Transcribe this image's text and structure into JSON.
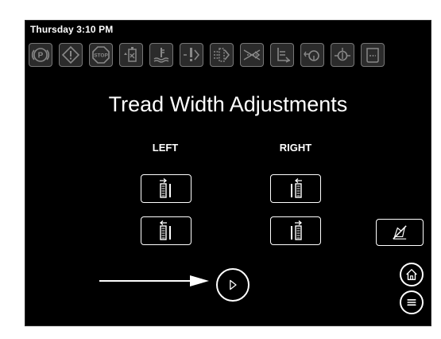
{
  "status": {
    "clock": "Thursday 3:10 PM"
  },
  "telltales": [
    {
      "name": "parking-brake-icon"
    },
    {
      "name": "warning-icon"
    },
    {
      "name": "stop-icon",
      "text": "STOP"
    },
    {
      "name": "coolant-level-icon"
    },
    {
      "name": "coolant-temp-icon"
    },
    {
      "name": "fuel-filter-icon"
    },
    {
      "name": "hydraulic-filter-icon"
    },
    {
      "name": "air-filter-icon"
    },
    {
      "name": "hydraulic-oil-icon"
    },
    {
      "name": "oil-level-icon"
    },
    {
      "name": "oil-pressure-icon"
    },
    {
      "name": "battery-icon"
    }
  ],
  "page": {
    "title": "Tread Width Adjustments",
    "left_label": "LEFT",
    "right_label": "RIGHT"
  },
  "buttons": {
    "left_in": {
      "icon": "tread-narrow-left-icon"
    },
    "left_out": {
      "icon": "tread-widen-left-icon"
    },
    "right_in": {
      "icon": "tread-narrow-right-icon"
    },
    "right_out": {
      "icon": "tread-widen-right-icon"
    },
    "next": {
      "icon": "play-icon"
    },
    "disable": {
      "icon": "disable-icon"
    },
    "home": {
      "icon": "home-icon"
    },
    "menu": {
      "icon": "menu-icon"
    }
  },
  "colors": {
    "background": "#000000",
    "telltale_fill": "#2b2b2b",
    "telltale_stroke": "#777777",
    "text": "#ffffff"
  }
}
